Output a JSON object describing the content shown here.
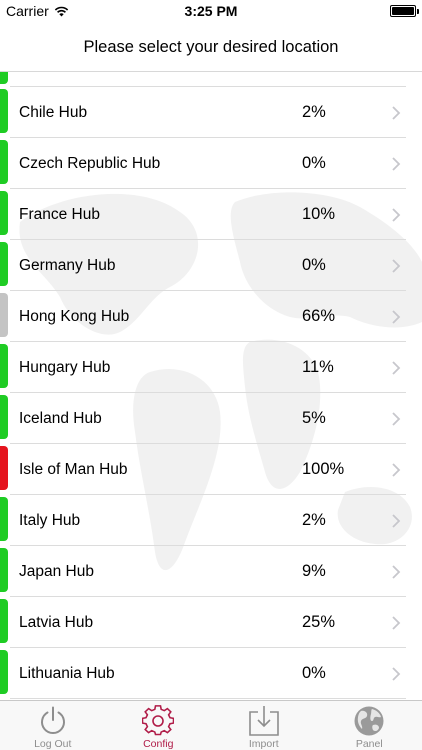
{
  "status_bar": {
    "carrier": "Carrier",
    "time": "3:25 PM"
  },
  "header": {
    "title": "Please select your desired location"
  },
  "colors": {
    "green": "#1fcc24",
    "gray": "#c4c4c4",
    "red": "#e5141e",
    "accent": "#b01c48"
  },
  "hubs": [
    {
      "name": "Chile Hub",
      "load": "2%",
      "status": "green"
    },
    {
      "name": "Czech Republic Hub",
      "load": "0%",
      "status": "green"
    },
    {
      "name": "France Hub",
      "load": "10%",
      "status": "green"
    },
    {
      "name": "Germany Hub",
      "load": "0%",
      "status": "green"
    },
    {
      "name": "Hong Kong Hub",
      "load": "66%",
      "status": "gray"
    },
    {
      "name": "Hungary Hub",
      "load": "11%",
      "status": "green"
    },
    {
      "name": "Iceland Hub",
      "load": "5%",
      "status": "green"
    },
    {
      "name": "Isle of Man Hub",
      "load": "100%",
      "status": "red"
    },
    {
      "name": "Italy Hub",
      "load": "2%",
      "status": "green"
    },
    {
      "name": "Japan Hub",
      "load": "9%",
      "status": "green"
    },
    {
      "name": "Latvia Hub",
      "load": "25%",
      "status": "green"
    },
    {
      "name": "Lithuania Hub",
      "load": "0%",
      "status": "green"
    }
  ],
  "tabs": [
    {
      "label": "Log Out",
      "icon": "power-icon",
      "active": false
    },
    {
      "label": "Config",
      "icon": "gear-icon",
      "active": true
    },
    {
      "label": "Import",
      "icon": "import-icon",
      "active": false
    },
    {
      "label": "Panel",
      "icon": "globe-icon",
      "active": false
    }
  ]
}
